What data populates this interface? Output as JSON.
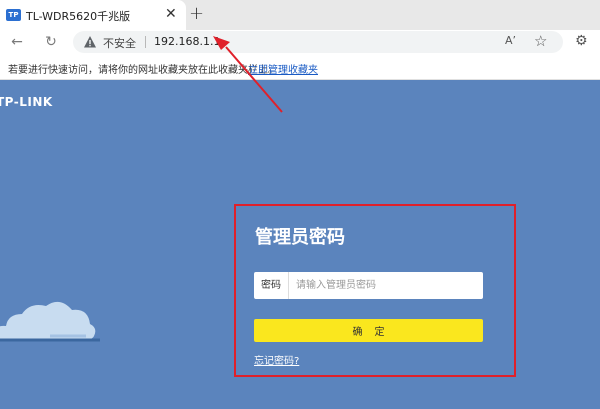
{
  "tab": {
    "favicon_text": "TP",
    "title": "TL-WDR5620千兆版",
    "close_glyph": "✕",
    "new_tab_glyph": "+"
  },
  "toolbar": {
    "back_glyph": "←",
    "reload_glyph": "↻",
    "security_label": "不安全",
    "url": "192.168.1.1",
    "read_aloud_glyph": "A’",
    "favorite_glyph": "☆",
    "extensions_glyph": "⚙"
  },
  "bookmarks": {
    "hint": "若要进行快速访问，请将你的网址收藏夹放在此收藏夹栏上。",
    "manage_link": "立即管理收藏夹"
  },
  "page": {
    "brand": "TP-LINK",
    "login": {
      "title": "管理员密码",
      "password_label": "密码",
      "password_placeholder": "请输入管理员密码",
      "confirm_label": "确定",
      "forgot_link": "忘记密码?"
    }
  },
  "colors": {
    "page_background": "#5b84bd",
    "confirm_button": "#fae71e",
    "highlight": "#e0202a"
  }
}
